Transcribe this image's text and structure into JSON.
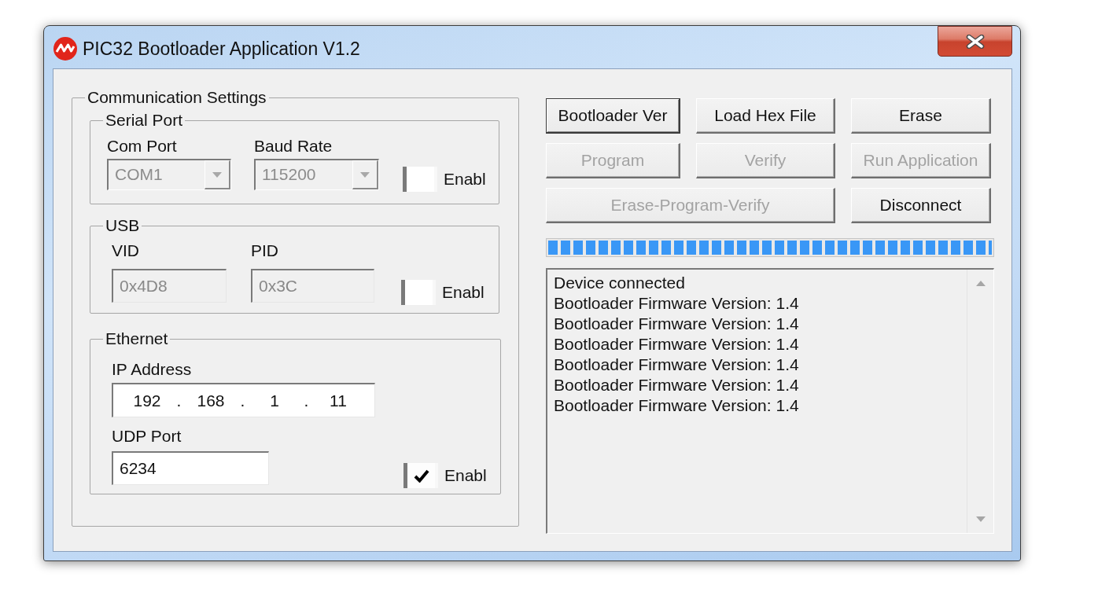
{
  "window": {
    "title": "PIC32 Bootloader Application V1.2"
  },
  "communication_settings": {
    "title": "Communication Settings",
    "serial_port": {
      "title": "Serial Port",
      "com_port": {
        "label": "Com Port",
        "value": "COM1",
        "disabled": true
      },
      "baud_rate": {
        "label": "Baud Rate",
        "value": "115200",
        "disabled": true
      },
      "enable": {
        "label": "Enabl",
        "checked": false
      }
    },
    "usb": {
      "title": "USB",
      "vid": {
        "label": "VID",
        "value": "0x4D8",
        "disabled": true
      },
      "pid": {
        "label": "PID",
        "value": "0x3C",
        "disabled": true
      },
      "enable": {
        "label": "Enabl",
        "checked": false
      }
    },
    "ethernet": {
      "title": "Ethernet",
      "ip_address": {
        "label": "IP Address",
        "octets": [
          "192",
          "168",
          "1",
          "11"
        ],
        "separators": [
          ".",
          ".",
          "."
        ]
      },
      "udp_port": {
        "label": "UDP Port",
        "value": "6234",
        "disabled": false
      },
      "enable": {
        "label": "Enabl",
        "checked": true
      }
    }
  },
  "button_rows": [
    [
      {
        "label": "Bootloader Ver",
        "disabled": false,
        "default": true
      },
      {
        "label": "Load Hex File",
        "disabled": false,
        "default": false
      },
      {
        "label": "Erase",
        "disabled": false,
        "default": false
      }
    ],
    [
      {
        "label": "Program",
        "disabled": true,
        "default": false
      },
      {
        "label": "Verify",
        "disabled": true,
        "default": false
      },
      {
        "label": "Run Application",
        "disabled": true,
        "default": false
      }
    ],
    [
      {
        "label": "Erase-Program-Verify",
        "disabled": true,
        "default": false
      },
      {
        "label": "Disconnect",
        "disabled": false,
        "default": false
      }
    ]
  ],
  "progress": {
    "level": 1
  },
  "log": {
    "lines": [
      "Device connected",
      "Bootloader Firmware Version: 1.4",
      "Bootloader Firmware Version: 1.4",
      "Bootloader Firmware Version: 1.4",
      "Bootloader Firmware Version: 1.4",
      "Bootloader Firmware Version: 1.4",
      "Bootloader Firmware Version: 1.4"
    ]
  }
}
